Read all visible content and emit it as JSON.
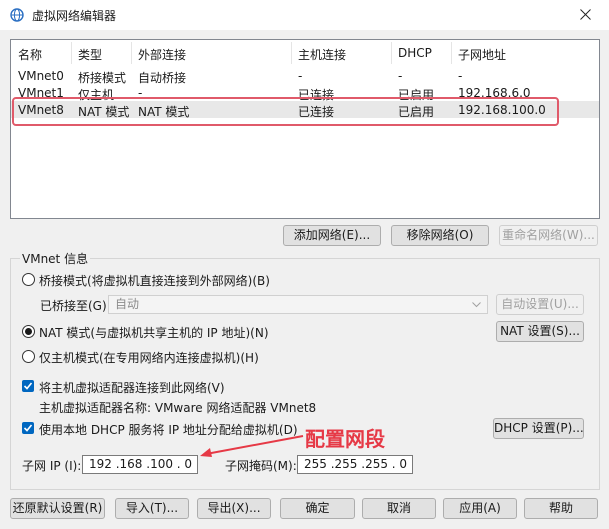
{
  "window": {
    "title": "虚拟网络编辑器",
    "icon": "globe-icon",
    "close_icon": "close-icon"
  },
  "network_table": {
    "headers": [
      "名称",
      "类型",
      "外部连接",
      "主机连接",
      "DHCP",
      "子网地址"
    ],
    "rows": [
      [
        "VMnet0",
        "桥接模式",
        "自动桥接",
        "-",
        "-",
        "-"
      ],
      [
        "VMnet1",
        "仅主机...",
        "-",
        "已连接",
        "已启用",
        "192.168.6.0"
      ],
      [
        "VMnet8",
        "NAT 模式",
        "NAT 模式",
        "已连接",
        "已启用",
        "192.168.100.0"
      ]
    ],
    "selected_row": 2,
    "highlight_color": "#e05a6a"
  },
  "table_buttons": {
    "add": "添加网络(E)...",
    "remove": "移除网络(O)",
    "rename": "重命名网络(W)..."
  },
  "vmnet_info": {
    "title": "VMnet 信息",
    "bridged_radio": "桥接模式(将虚拟机直接连接到外部网络)(B)",
    "bridged_to_label": "已桥接至(G):",
    "bridged_to_value": "自动",
    "auto_settings": "自动设置(U)...",
    "nat_radio": "NAT 模式(与虚拟机共享主机的 IP 地址)(N)",
    "nat_settings": "NAT 设置(S)...",
    "hostonly_radio": "仅主机模式(在专用网络内连接虚拟机)(H)",
    "selected_mode": "nat",
    "connect_adapter": "将主机虚拟适配器连接到此网络(V)",
    "adapter_name": "主机虚拟适配器名称: VMware 网络适配器 VMnet8",
    "use_dhcp": "使用本地 DHCP 服务将 IP 地址分配给虚拟机(D)",
    "dhcp_settings": "DHCP 设置(P)...",
    "subnet_ip_label": "子网 IP (I):",
    "subnet_ip_value": "192 .168 .100 .  0",
    "subnet_mask_label": "子网掩码(M):",
    "subnet_mask_value": "255 .255 .255 .  0"
  },
  "annotation": {
    "text": "配置网段",
    "color": "#e63946"
  },
  "bottom_buttons": {
    "restore": "还原默认设置(R)",
    "import": "导入(T)...",
    "export": "导出(X)...",
    "ok": "确定",
    "cancel": "取消",
    "apply": "应用(A)",
    "help": "帮助"
  }
}
